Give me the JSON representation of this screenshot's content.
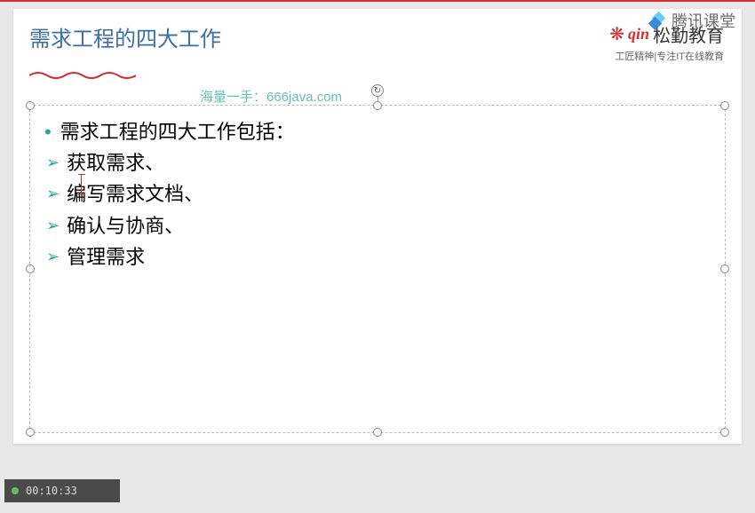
{
  "slide": {
    "title": "需求工程的四大工作",
    "watermark": "海量一手：666java.com",
    "items": [
      {
        "bullet": "dot",
        "text": "需求工程的四大工作包括："
      },
      {
        "bullet": "arrow",
        "text": "获取需求、"
      },
      {
        "bullet": "arrow",
        "text": "编写需求文档、"
      },
      {
        "bullet": "arrow",
        "text": "确认与协商、"
      },
      {
        "bullet": "arrow",
        "text": "管理需求"
      }
    ]
  },
  "brand": {
    "script": "qin",
    "name": "松勤教育",
    "tagline": "工匠精神|专注IT在线教育"
  },
  "tencent": {
    "label": "腾讯课堂"
  },
  "player": {
    "time": "00:10:33"
  }
}
